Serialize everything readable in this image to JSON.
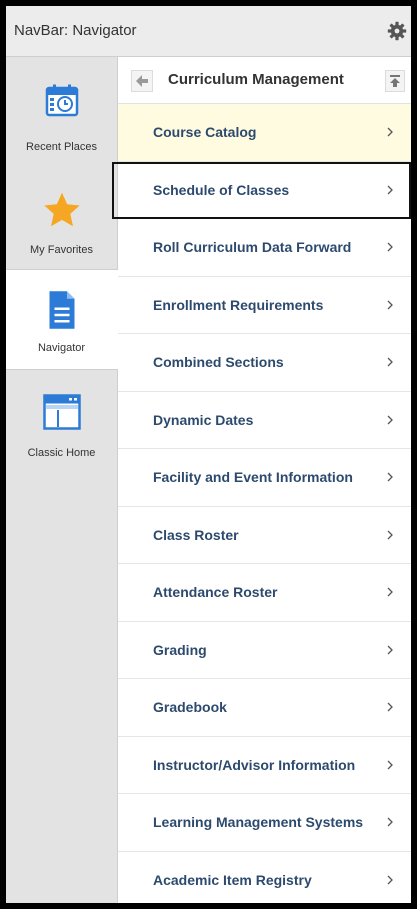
{
  "header": {
    "title": "NavBar: Navigator"
  },
  "sidebar": {
    "items": [
      {
        "label": "Recent Places",
        "icon": "calendar-clock-icon"
      },
      {
        "label": "My Favorites",
        "icon": "star-icon"
      },
      {
        "label": "Navigator",
        "icon": "document-icon"
      },
      {
        "label": "Classic Home",
        "icon": "browser-window-icon"
      }
    ]
  },
  "panel": {
    "title": "Curriculum Management",
    "items": [
      "Course Catalog",
      "Schedule of Classes",
      "Roll Curriculum Data Forward",
      "Enrollment Requirements",
      "Combined Sections",
      "Dynamic Dates",
      "Facility and Event Information",
      "Class Roster",
      "Attendance Roster",
      "Grading",
      "Gradebook",
      "Instructor/Advisor Information",
      "Learning Management Systems",
      "Academic Item Registry"
    ]
  },
  "colors": {
    "link": "#2d4a6e",
    "highlight": "#fffbe0",
    "star": "#f5a623",
    "icon_blue": "#2c7bd6"
  }
}
